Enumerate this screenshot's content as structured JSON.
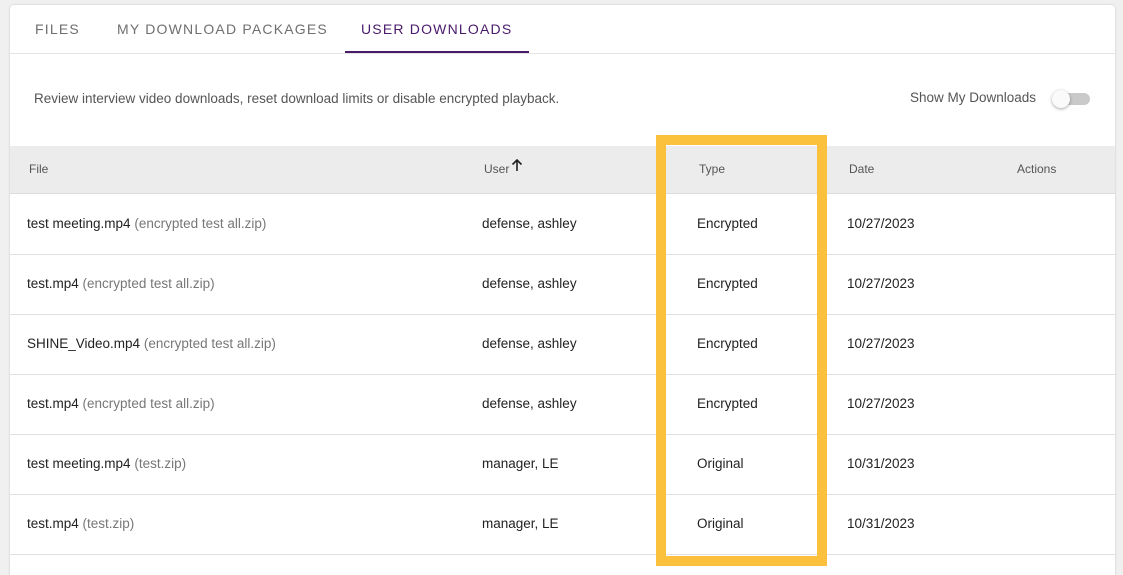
{
  "tabs": [
    {
      "label": "FILES",
      "active": false
    },
    {
      "label": "MY DOWNLOAD PACKAGES",
      "active": false
    },
    {
      "label": "USER DOWNLOADS",
      "active": true
    }
  ],
  "description": "Review interview video downloads, reset download limits or disable encrypted playback.",
  "toggle": {
    "label": "Show My Downloads",
    "on": false
  },
  "table": {
    "headers": {
      "file": "File",
      "user": "User",
      "type": "Type",
      "date": "Date",
      "actions": "Actions"
    },
    "sort": {
      "column": "User",
      "direction": "ascending",
      "icon": "arrow-up-icon"
    },
    "rows": [
      {
        "file": "test meeting.mp4",
        "package": "(encrypted test all.zip)",
        "user": "defense, ashley",
        "type": "Encrypted",
        "date": "10/27/2023"
      },
      {
        "file": "test.mp4",
        "package": "(encrypted test all.zip)",
        "user": "defense, ashley",
        "type": "Encrypted",
        "date": "10/27/2023"
      },
      {
        "file": "SHINE_Video.mp4",
        "package": "(encrypted test all.zip)",
        "user": "defense, ashley",
        "type": "Encrypted",
        "date": "10/27/2023"
      },
      {
        "file": "test.mp4",
        "package": "(encrypted test all.zip)",
        "user": "defense, ashley",
        "type": "Encrypted",
        "date": "10/27/2023"
      },
      {
        "file": "test meeting.mp4",
        "package": "(test.zip)",
        "user": "manager, LE",
        "type": "Original",
        "date": "10/31/2023"
      },
      {
        "file": "test.mp4",
        "package": "(test.zip)",
        "user": "manager, LE",
        "type": "Original",
        "date": "10/31/2023"
      }
    ]
  },
  "colors": {
    "accent": "#4a1a6b",
    "highlight": "#fbc13d",
    "header_bg": "#ececec"
  }
}
